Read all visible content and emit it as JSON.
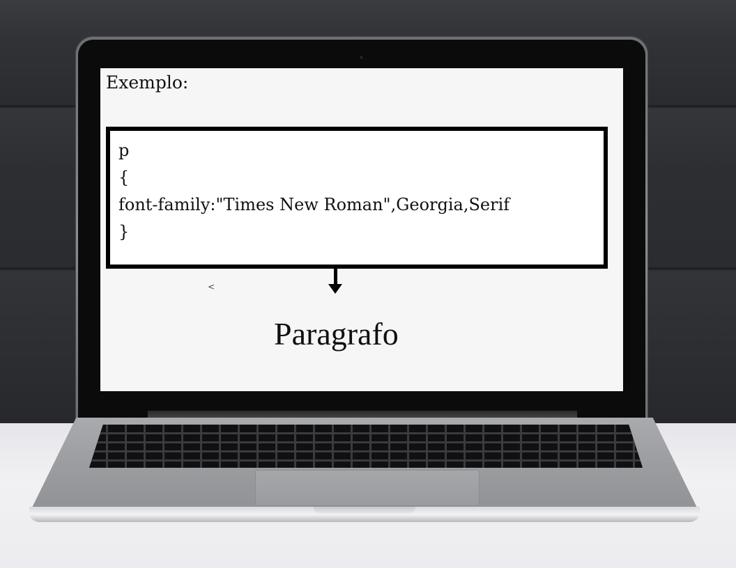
{
  "screen": {
    "example_label": "Exemplo:",
    "code_lines": [
      "p",
      "{",
      "font-family:\"Times New Roman\",Georgia,Serif",
      "}"
    ],
    "cursor_glyph": "<",
    "result_text": "Paragrafo"
  },
  "colors": {
    "wall": "#2b2d31",
    "screen_bg": "#f6f6f6",
    "code_border": "#000000",
    "laptop_silver": "#9c9da1",
    "table": "#ececef"
  },
  "icons": {
    "arrow": "arrow-down-icon"
  }
}
